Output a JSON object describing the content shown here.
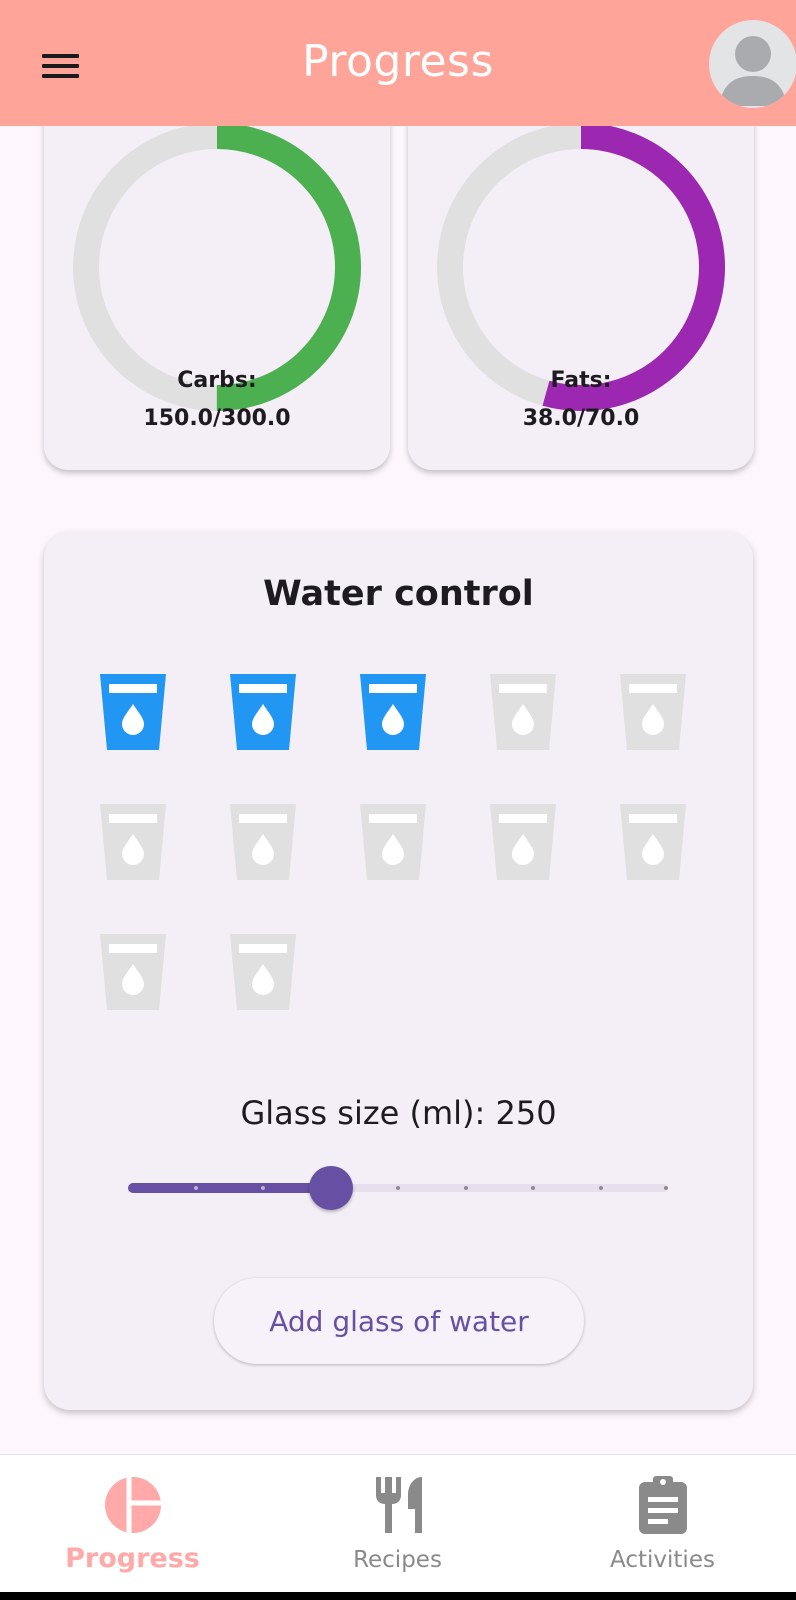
{
  "app_bar": {
    "title": "Progress",
    "menu_icon": "hamburger-menu-icon",
    "avatar_icon": "account-circle-icon"
  },
  "macros": [
    {
      "name": "Carbs:",
      "value": "150.0/300.0",
      "current": 150.0,
      "goal": 300.0,
      "color": "#4caf50"
    },
    {
      "name": "Fats:",
      "value": "38.0/70.0",
      "current": 38.0,
      "goal": 70.0,
      "color": "#9c27b0"
    }
  ],
  "water": {
    "title": "Water control",
    "glasses_filled": 3,
    "glasses_total": 12,
    "filled_color": "#2196f3",
    "empty_color": "#e0e0e0",
    "glass_icon": "water-glass-icon",
    "glass_size_text": "Glass size (ml): 250",
    "slider": {
      "value": 250,
      "min": 100,
      "max": 500,
      "divisions": 8
    },
    "add_button_label": "Add glass of water"
  },
  "bottom_nav": {
    "items": [
      {
        "label": "Progress",
        "icon": "pie-chart-icon",
        "active": true
      },
      {
        "label": "Recipes",
        "icon": "restaurant-icon",
        "active": false
      },
      {
        "label": "Activities",
        "icon": "clipboard-icon",
        "active": false
      }
    ]
  },
  "colors": {
    "app_bar": "#ffa498",
    "accent": "#6750a4",
    "active_nav": "#ffa9a9",
    "inactive_nav": "#8a8a8a",
    "ring_track": "#e0e0e0"
  }
}
